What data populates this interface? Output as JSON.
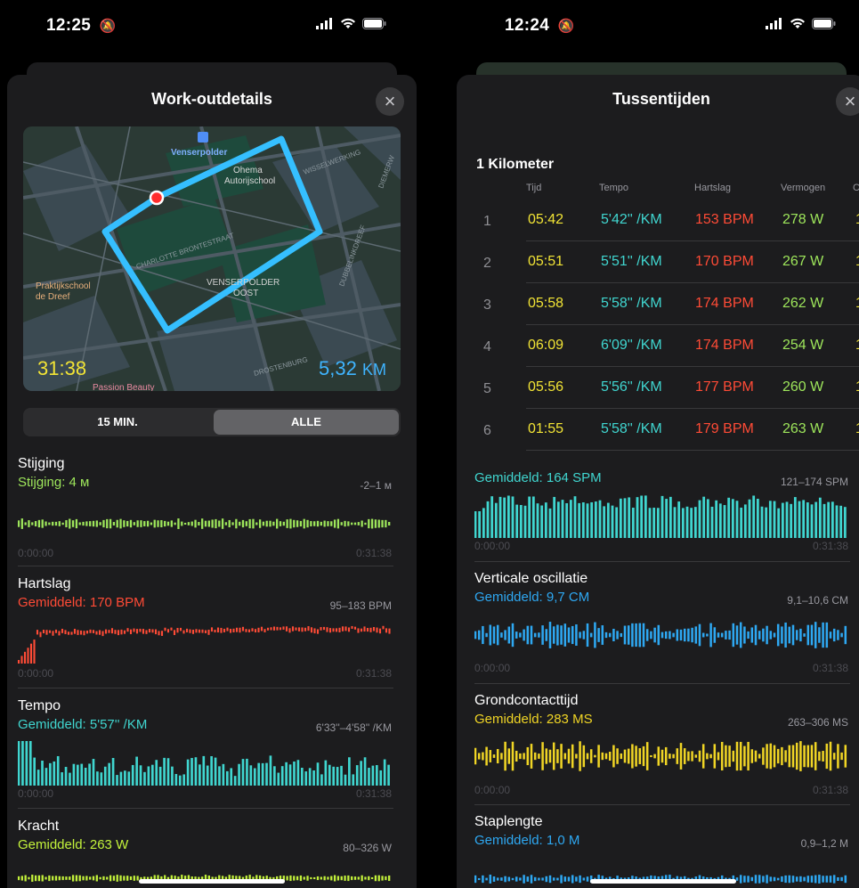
{
  "left": {
    "status": {
      "time": "12:25"
    },
    "sheet": {
      "title": "Work-outdetails"
    },
    "map": {
      "time": "31:38",
      "distance": "5,32",
      "distance_unit": "KM",
      "labels": {
        "station": "Venserpolder",
        "poi1": "Ohema",
        "poi2": "Autorijschool",
        "school1": "Praktijkschool",
        "school2": "de Dreef",
        "district1": "VENSERPOLDER",
        "district2": "OOST",
        "street1": "CHARLOTTE BRONTESTRAAT",
        "street2": "DUBBELINKDREEF",
        "street3": "WISSELWERKING",
        "street4": "DIEMERW",
        "street5": "DROSTENBURG",
        "poi3": "Passion Beauty"
      }
    },
    "segment": {
      "options": [
        "15 MIN.",
        "ALLE"
      ],
      "selected": "ALLE"
    },
    "metrics": [
      {
        "title": "Stijging",
        "subtitle": "Stijging: 4 м",
        "range": "-2–1 м",
        "start": "0:00:00",
        "end": "0:31:38",
        "color": "#9ee65b"
      },
      {
        "title": "Hartslag",
        "subtitle": "Gemiddeld: 170 BPM",
        "range": "95–183 BPM",
        "start": "0:00:00",
        "end": "0:31:38",
        "color": "#ff4b36"
      },
      {
        "title": "Tempo",
        "subtitle": "Gemiddeld: 5'57'' /KM",
        "range": "6'33''–4'58'' /KM",
        "start": "0:00:00",
        "end": "0:31:38",
        "color": "#40d6d0"
      },
      {
        "title": "Kracht",
        "subtitle": "Gemiddeld: 263 W",
        "range": "80–326 W",
        "start": "",
        "end": "",
        "color": "#c3f23b"
      }
    ]
  },
  "right": {
    "status": {
      "time": "12:24"
    },
    "sheet": {
      "title": "Tussentijden"
    },
    "splits": {
      "title": "1 Kilometer",
      "headers": [
        "Tijd",
        "Tempo",
        "Hartslag",
        "Vermogen"
      ],
      "rows": [
        {
          "n": "1",
          "time": "05:42",
          "pace": "5'42'' /KM",
          "hr": "153 BPM",
          "power": "278 W"
        },
        {
          "n": "2",
          "time": "05:51",
          "pace": "5'51'' /KM",
          "hr": "170 BPM",
          "power": "267 W"
        },
        {
          "n": "3",
          "time": "05:58",
          "pace": "5'58'' /KM",
          "hr": "174 BPM",
          "power": "262 W"
        },
        {
          "n": "4",
          "time": "06:09",
          "pace": "6'09'' /KM",
          "hr": "174 BPM",
          "power": "254 W"
        },
        {
          "n": "5",
          "time": "05:56",
          "pace": "5'56'' /KM",
          "hr": "177 BPM",
          "power": "260 W"
        },
        {
          "n": "6",
          "time": "01:55",
          "pace": "5'58'' /KM",
          "hr": "179 BPM",
          "power": "263 W"
        }
      ]
    },
    "metrics": [
      {
        "title": "",
        "subtitle": "Gemiddeld: 164 SPM",
        "range": "121–174 SPM",
        "start": "0:00:00",
        "end": "0:31:38",
        "color": "#40d6d0"
      },
      {
        "title": "Verticale oscillatie",
        "subtitle": "Gemiddeld: 9,7 CM",
        "range": "9,1–10,6 CM",
        "start": "0:00:00",
        "end": "0:31:38",
        "color": "#2ea8f2"
      },
      {
        "title": "Grondcontacttijd",
        "subtitle": "Gemiddeld: 283 MS",
        "range": "263–306 MS",
        "start": "0:00:00",
        "end": "0:31:38",
        "color": "#f0d525"
      },
      {
        "title": "Staplengte",
        "subtitle": "Gemiddeld: 1,0 M",
        "range": "0,9–1,2 M",
        "start": "",
        "end": "",
        "color": "#2ea8f2"
      }
    ]
  },
  "colors": {
    "time": "#f2e435",
    "pace": "#40d6d0",
    "hr": "#ff4b36",
    "power": "#9ee65b",
    "sheet": "#1c1c1e"
  }
}
